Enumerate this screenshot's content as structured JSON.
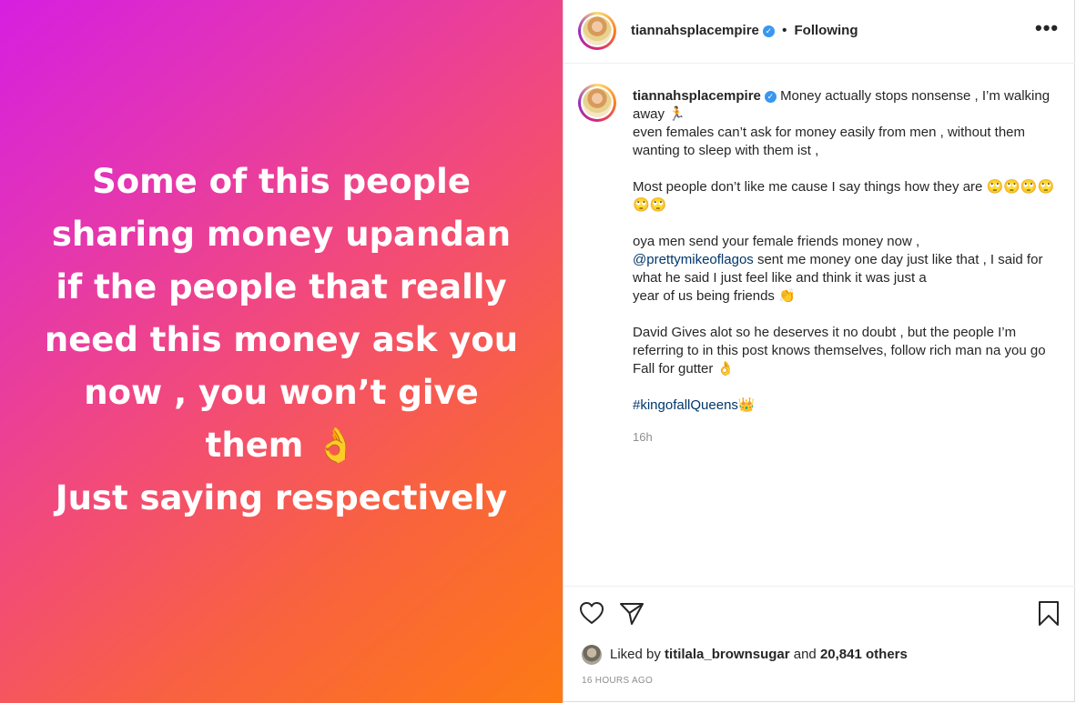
{
  "story": {
    "text": "Some of this people\nsharing money upandan\nif the people that really\nneed this money ask you\nnow , you won’t give\nthem 👌\nJust saying respectively"
  },
  "header": {
    "username": "tiannahsplacempire",
    "separator": "•",
    "follow_status": "Following",
    "more_icon": "•••"
  },
  "caption": {
    "username": "tiannahsplacempire",
    "line1": "Money actually stops nonsense , I’m walking away 🏃",
    "line2": "even females can’t ask for money easily from men , without them wanting to sleep with them ist ,",
    "line3": "Most people don’t like me cause I say things how they are 🙄🙄🙄🙄🙄🙄",
    "line4": "oya men send your female friends money now ,",
    "mention": "@prettymikeoflagos",
    "line5": " sent me money one day just like that , I said for what he said I just feel like and think it was just a\nyear of us being friends 👏",
    "line6": "David Gives alot so he deserves it no doubt , but the people I’m referring to in this post knows themselves, follow rich man na you go Fall for gutter 👌",
    "hashtag": "#kingofallQueens👑",
    "time_ago": "16h"
  },
  "actions": {
    "liked_prefix": "Liked by",
    "liked_user": "titilala_brownsugar",
    "liked_and": "and",
    "liked_count": "20,841 others",
    "timestamp": "16 HOURS AGO"
  }
}
